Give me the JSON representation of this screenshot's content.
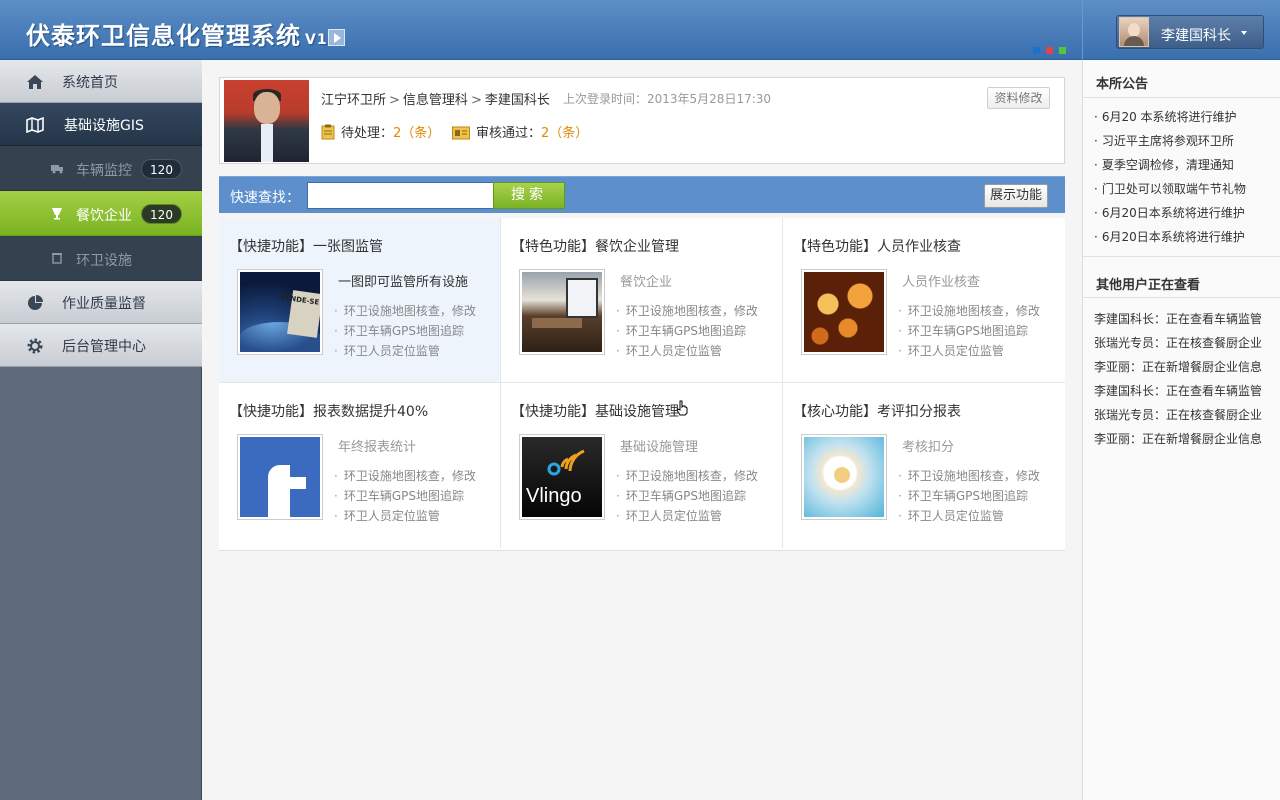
{
  "header": {
    "title": "伏泰环卫信息化管理系统",
    "version": "V1.2",
    "skin_colors": [
      "#1d6fd0",
      "#e04545",
      "#55c63a"
    ],
    "user": {
      "name": "李建国科长"
    }
  },
  "sidebar": {
    "items": [
      {
        "label": "系统首页",
        "icon": "home-icon"
      },
      {
        "label": "基础设施GIS",
        "icon": "map-icon"
      },
      {
        "label": "作业质量监督",
        "icon": "pie-chart-icon"
      },
      {
        "label": "后台管理中心",
        "icon": "gear-icon"
      }
    ],
    "sub_items": [
      {
        "label": "车辆监控",
        "badge": "120",
        "icon": "truck-icon"
      },
      {
        "label": "餐饮企业",
        "badge": "120",
        "icon": "cup-icon"
      },
      {
        "label": "环卫设施",
        "icon": "bin-icon"
      }
    ]
  },
  "profile": {
    "breadcrumb": [
      "江宁环卫所",
      "信息管理科",
      "李建国科长"
    ],
    "last_login": "上次登录时间：2013年5月28日17:30",
    "edit_label": "资料修改",
    "pending_label": "待处理：",
    "pending_value": "2（条）",
    "approved_label": "审核通过：",
    "approved_value": "2（条）"
  },
  "search": {
    "label": "快速查找：",
    "value": "",
    "placeholder": "",
    "button": "搜索",
    "show_button": "展示功能"
  },
  "features": [
    {
      "title": "【快捷功能】一张图监管",
      "subtitle": "一图即可监管所有设施",
      "items": [
        "环卫设施地图核查，修改",
        "环卫车辆GPS地图追踪",
        "环卫人员定位监管"
      ]
    },
    {
      "title": "【特色功能】餐饮企业管理",
      "subtitle": "餐饮企业",
      "items": [
        "环卫设施地图核查，修改",
        "环卫车辆GPS地图追踪",
        "环卫人员定位监管"
      ]
    },
    {
      "title": "【特色功能】人员作业核查",
      "subtitle": "人员作业核查",
      "items": [
        "环卫设施地图核查，修改",
        "环卫车辆GPS地图追踪",
        "环卫人员定位监管"
      ]
    },
    {
      "title": "【快捷功能】报表数据提升40%",
      "subtitle": "年终报表统计",
      "items": [
        "环卫设施地图核查，修改",
        "环卫车辆GPS地图追踪",
        "环卫人员定位监管"
      ]
    },
    {
      "title": "【快捷功能】基础设施管理",
      "subtitle": "基础设施管理",
      "items": [
        "环卫设施地图核查，修改",
        "环卫车辆GPS地图追踪",
        "环卫人员定位监管"
      ],
      "logo_text": "Vlingo"
    },
    {
      "title": "【核心功能】考评扣分报表",
      "subtitle": "考核扣分",
      "items": [
        "环卫设施地图核查，修改",
        "环卫车辆GPS地图追踪",
        "环卫人员定位监管"
      ]
    }
  ],
  "thumb_text": "VENDE-SE",
  "right": {
    "notice_title": "本所公告",
    "notices": [
      "6月20 本系统将进行维护",
      "习近平主席将参观环卫所",
      "夏季空调检修，清理通知",
      "门卫处可以领取端午节礼物",
      "6月20日本系统将进行维护",
      "6月20日本系统将进行维护"
    ],
    "viewers_title": "其他用户正在查看",
    "viewers": [
      "李建国科长：正在查看车辆监管",
      "张瑞光专员：正在核查餐厨企业",
      "李亚丽：正在新增餐厨企业信息",
      "李建国科长：正在查看车辆监管",
      "张瑞光专员：正在核查餐厨企业",
      "李亚丽：正在新增餐厨企业信息"
    ]
  }
}
